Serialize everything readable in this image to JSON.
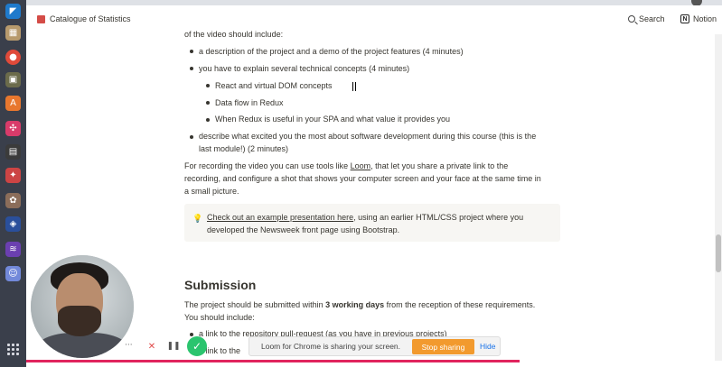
{
  "topbar": {
    "page_title": "Catalogue of Statistics",
    "search_label": "Search",
    "notion_label": "Notion"
  },
  "content": {
    "intro": "of the video should include:",
    "bullets": [
      "a description of the project and a demo of the project features (4 minutes)",
      "you have to explain several technical concepts (4 minutes)"
    ],
    "sub_bullets": [
      "React and virtual DOM concepts",
      "Data flow in Redux",
      "When Redux is useful in your SPA and what value it provides you"
    ],
    "bullet3_line1": "describe what excited you the most about software development during this course (this is the",
    "bullet3_line2": "last module!) (2 minutes)",
    "para_line1_a": "For recording the video you can use tools like ",
    "para_link": "Loom",
    "para_line1_b": ", that let you share a private link to the",
    "para_line2": "recording, and configure a shot that shows your computer screen and your face at the same time in",
    "para_line3": "a small picture.",
    "callout_link": "Check out an example presentation here",
    "callout_text": ", using an earlier HTML/CSS project where you",
    "callout_line2": "developed the Newsweek front page using Bootstrap.",
    "submission_heading": "Submission",
    "sub_text_a": "The project should be submitted within ",
    "sub_text_bold": "3 working days",
    "sub_text_b": " from the reception of these requirements.",
    "sub_text_line2": "You should include:",
    "sub_bullet1": "a link to the repository pull-request (as you have in previous projects)",
    "sub_bullet2": "a link to the"
  },
  "loom": {
    "share_message": "Loom for Chrome is sharing your screen.",
    "stop_label": "Stop sharing",
    "hide_label": "Hide"
  },
  "colors": {
    "accent_orange": "#f29a2e",
    "check_green": "#2bc46e",
    "record_red": "#e0245e"
  }
}
